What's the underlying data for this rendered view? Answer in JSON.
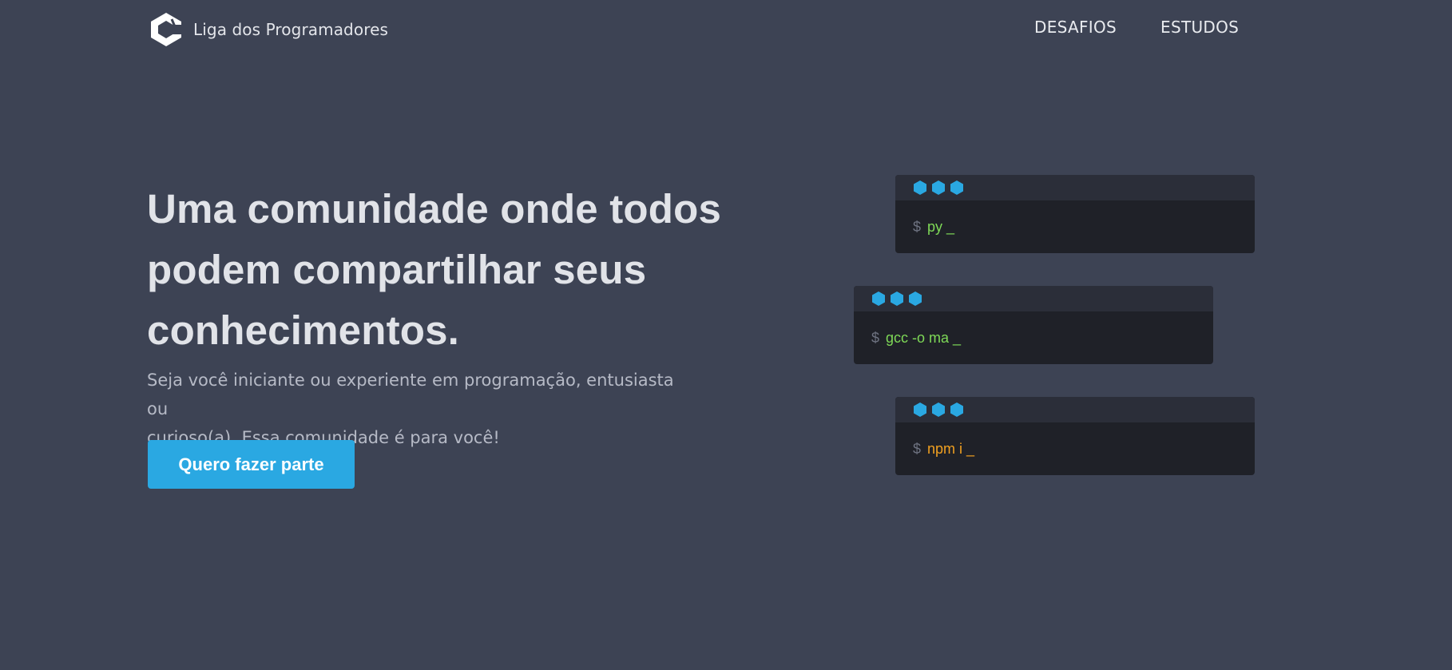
{
  "header": {
    "brand_name": "Liga dos Programadores",
    "logo_icon": "hexagon-logo-icon",
    "nav": [
      {
        "label": "DESAFIOS"
      },
      {
        "label": "ESTUDOS"
      }
    ]
  },
  "hero": {
    "title_lines": [
      "Uma comunidade onde todos",
      "podem compartilhar seus",
      "conhecimentos."
    ],
    "subtitle_lines": [
      "Seja você iniciante ou experiente em programação, entusiasta ou",
      "curioso(a). Essa comunidade é para você!"
    ],
    "cta_label": "Quero fazer parte"
  },
  "terminals": [
    {
      "prompt": "$",
      "command": "py _",
      "command_color": "#7ed957"
    },
    {
      "prompt": "$",
      "command": "gcc -o ma _",
      "command_color": "#7ed957"
    },
    {
      "prompt": "$",
      "command": "npm i _",
      "command_color": "#f0a020"
    }
  ],
  "colors": {
    "background": "#3d4354",
    "accent": "#2aa8e2",
    "terminal_bg": "#1f2128",
    "terminal_bar": "#2b2e39"
  }
}
